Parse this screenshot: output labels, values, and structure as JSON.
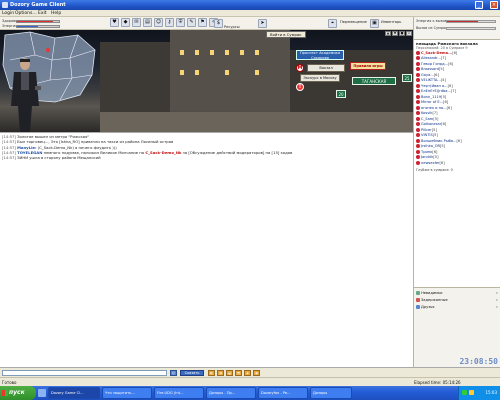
{
  "window": {
    "title": "Dozory Game Client"
  },
  "menu": [
    "Login",
    "Options...",
    "Exit",
    "Help"
  ],
  "stats": {
    "hp_label": "Здоровье",
    "energy_label": "Энергия",
    "hp_fraction": 0.85,
    "energy_fraction": 0.5
  },
  "toolbar": {
    "items": [
      "Ресурсы",
      "Перемещение",
      "Инвентарь"
    ]
  },
  "right_top": {
    "rows": [
      {
        "label": "Энергия к вызову",
        "fraction": 0.65,
        "color": "#c33030"
      },
      {
        "label": "Вызов из Сумрака",
        "fraction": 0.0,
        "color": "#3a6bc6"
      }
    ]
  },
  "game": {
    "location_tag": "Войти в Сумрак",
    "buttons": [
      {
        "label": "Вокзал",
        "style": "normal"
      },
      {
        "label": "Экскурс в Москву",
        "style": "normal"
      },
      {
        "label": "Правила игры",
        "style": "red"
      }
    ],
    "sign_blue_1": "Проспект Академика Сахарова",
    "sign_green_1": "ЗАПАДНАЯ",
    "sign_green_2": "ТАГАНСКАЯ",
    "sign_green_3": "20",
    "sign_green_4": "25",
    "metro_label": "M",
    "tools": [
      "▲",
      "▼",
      "■",
      "×"
    ]
  },
  "chat": [
    {
      "time": "[14:57]",
      "text": "Золотое вышел из метро \"Рижская\""
    },
    {
      "time": "[14:57]",
      "text": "Был торговец..., Это [Ishka_RO] привезли на такси из района Лосиный остров"
    },
    {
      "time": "[14:57]",
      "nick": "ManyLie:",
      "text": " (C_Sack-Demo_Nk) а ничего флудить )))"
    },
    {
      "time": "[14:57]",
      "nick": "TOYELEGAN",
      "text": " немного подумав, наложил Великое Молчание на ",
      "red": "C_Sack-Demo_Nk",
      "tail": " за [Обсуждение действий модераторов] на [15] ходов"
    },
    {
      "time": "[14:57]",
      "text": "ЗИНИ ушла в сторону района Мещанский"
    }
  ],
  "users": {
    "location_title": "площадь Рижского вокзала",
    "location_sub": "Персонажей: 20 в Сумраке 9",
    "list": [
      {
        "name": "C_Sack-Demo...",
        "level": "[6]",
        "red": true
      },
      {
        "name": "Allesandr...",
        "level": "[7]",
        "red": false
      },
      {
        "name": "Гевор Гонрд...",
        "level": "[6]",
        "red": false
      },
      {
        "name": "Broassard",
        "level": "[5]",
        "red": false
      },
      {
        "name": "Gaya...",
        "level": "[6]",
        "red": false
      },
      {
        "name": "VELIKTTA...",
        "level": "[4]",
        "red": false
      },
      {
        "name": "Черт(Иван о...",
        "level": "[6]",
        "red": false
      },
      {
        "name": "ЕлЕнЕтЕ(Jrdba...",
        "level": "[7]",
        "red": false
      },
      {
        "name": "Bonn_1119",
        "level": "[5]",
        "red": false
      },
      {
        "name": "Mirror of E...",
        "level": "[6]",
        "red": false
      },
      {
        "name": "огонек и по...",
        "level": "[6]",
        "red": false
      },
      {
        "name": "Kosvik",
        "level": "[7]",
        "red": false
      },
      {
        "name": "C_Sam",
        "level": "[5]",
        "red": false
      },
      {
        "name": "Galkonesar",
        "level": "[6]",
        "red": false
      },
      {
        "name": "Pillcer",
        "level": "[5]",
        "red": false
      },
      {
        "name": "VINTIS",
        "level": "[5]",
        "red": false
      },
      {
        "name": "Волшебник Рыба...",
        "level": "[6]",
        "red": false
      },
      {
        "name": "Jrsihka_OR",
        "level": "[5]",
        "red": false
      },
      {
        "name": "Тринк",
        "level": "[6]",
        "red": false
      },
      {
        "name": "Jandrik",
        "level": "[5]",
        "red": false
      },
      {
        "name": "newsexfer",
        "level": "[6]",
        "red": false
      }
    ],
    "footer": "Глубже в сумраке: 0"
  },
  "bottom_panel": {
    "items": [
      "Невидимки",
      "Задержанные",
      "Друзья"
    ],
    "clock": "23:08:50"
  },
  "input": {
    "value": "",
    "say_label": "Сказать"
  },
  "status": {
    "ready": "Готово",
    "elapsed": "Elapsed time: 05:14:26"
  },
  "taskbar": {
    "start_label": "пуск",
    "tasks": [
      "Dozory Game Cl...",
      "Что защитить...",
      "Fire.UDG (Int...",
      "Дозоры - Пр...",
      "Dozoryfax - Pe...",
      "Дозоры"
    ],
    "time": "15:03"
  }
}
